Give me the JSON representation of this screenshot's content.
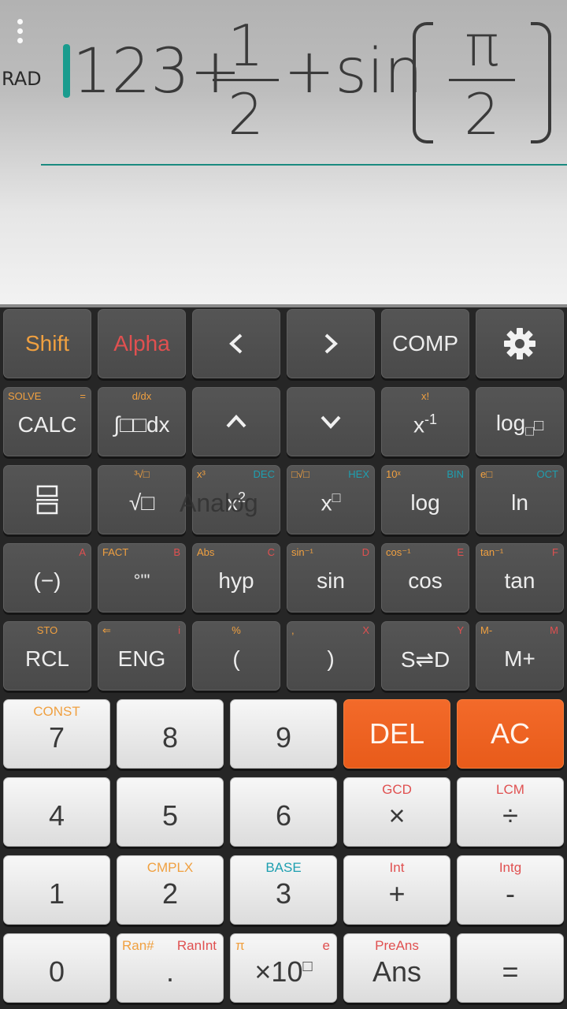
{
  "display": {
    "mode": "RAD",
    "expr_int": "123+",
    "frac1_num": "1",
    "frac1_den": "2",
    "expr_mid": "+sin",
    "frac2_num": "π",
    "frac2_den": "2",
    "cursor_color": "#1a9c8e"
  },
  "overlay_hint": "Analog",
  "rows": {
    "r1": {
      "shift": "Shift",
      "alpha": "Alpha",
      "left": "<",
      "right": ">",
      "comp": "COMP",
      "settings_icon": "gear-icon"
    },
    "r2": {
      "calc": "CALC",
      "calc_top_l": "SOLVE",
      "calc_top_r": "=",
      "int_top": "d/dx",
      "int_label": "∫□□dx",
      "xinv_top": "x!",
      "xinv_base": "x",
      "xinv_exp": "-1",
      "log_base": "log",
      "log_sub": "□",
      "log_box": "□"
    },
    "r3": {
      "frac_icon": "fraction-icon",
      "sqrt": "√□",
      "sqrt_top": "³√□",
      "sq_base": "x",
      "sq_exp": "2",
      "sq_top_l": "x³",
      "sq_top_r": "DEC",
      "pow_base": "x",
      "pow_exp": "□",
      "pow_top_l": "□√□",
      "pow_top_r": "HEX",
      "log": "log",
      "log_top_l": "10ˣ",
      "log_top_r": "BIN",
      "ln": "ln",
      "ln_top_l": "e□",
      "ln_top_r": "OCT"
    },
    "r4": {
      "neg": "(−)",
      "neg_top_r": "A",
      "deg": "°'\"",
      "deg_top_l": "FACT",
      "deg_top_r": "B",
      "hyp": "hyp",
      "hyp_top_l": "Abs",
      "hyp_top_r": "C",
      "sin": "sin",
      "sin_top_l": "sin⁻¹",
      "sin_top_r": "D",
      "cos": "cos",
      "cos_top_l": "cos⁻¹",
      "cos_top_r": "E",
      "tan": "tan",
      "tan_top_l": "tan⁻¹",
      "tan_top_r": "F"
    },
    "r5": {
      "rcl": "RCL",
      "rcl_top": "STO",
      "eng": "ENG",
      "eng_top_l": "⇐",
      "eng_top_r": "i",
      "lparen": "(",
      "lparen_top": "%",
      "rparen": ")",
      "rparen_top_l": ",",
      "rparen_top_r": "X",
      "sd": "S⇌D",
      "sd_top_r": "Y",
      "mplus": "M+",
      "mplus_top_l": "M-",
      "mplus_top_r": "M"
    }
  },
  "numpad": {
    "k7": "7",
    "k7_top": "CONST",
    "k8": "8",
    "k9": "9",
    "del": "DEL",
    "ac": "AC",
    "k4": "4",
    "k5": "5",
    "k6": "6",
    "mul": "×",
    "mul_top": "GCD",
    "div": "÷",
    "div_top": "LCM",
    "k1": "1",
    "k2": "2",
    "k2_top": "CMPLX",
    "k3": "3",
    "k3_top": "BASE",
    "plus": "+",
    "plus_top": "Int",
    "minus": "-",
    "minus_top": "Intg",
    "k0": "0",
    "dot": ".",
    "dot_top_l": "Ran#",
    "dot_top_r": "RanInt",
    "exp_label": "×10",
    "exp_box": "□",
    "exp_top_l": "π",
    "exp_top_r": "e",
    "ans": "Ans",
    "ans_top": "PreAns",
    "eq": "="
  }
}
